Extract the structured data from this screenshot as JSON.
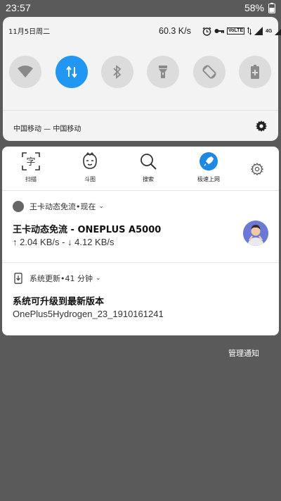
{
  "status_bar": {
    "time": "23:57",
    "battery": "58%"
  },
  "quick_settings": {
    "date": "11月5日周二",
    "speed": "60.3 K/s",
    "volte": "VoLTE",
    "network": "4G",
    "carrier": "中国移动 — 中国移动",
    "tiles": [
      "wifi",
      "mobile-data",
      "bluetooth",
      "flashlight",
      "auto-rotate",
      "battery-saver"
    ],
    "active_color": "#2196f3"
  },
  "shortcuts": [
    {
      "label": "扫描",
      "icon": "scan-text-icon"
    },
    {
      "label": "斗图",
      "icon": "emoji-face-icon"
    },
    {
      "label": "搜索",
      "icon": "search-icon"
    },
    {
      "label": "极速上网",
      "icon": "rocket-icon"
    }
  ],
  "notifications": [
    {
      "app": "王卡动态免流",
      "time_sep": " • ",
      "time": "现在",
      "title": "王卡动态免流 - ONEPLUS A5000",
      "subtitle": "↑ 2.04 KB/s  -  ↓ 4.12 KB/s"
    },
    {
      "app": "系统更新",
      "time_sep": " • ",
      "time": "41 分钟",
      "title": "系统可升级到最新版本",
      "subtitle": "OnePlus5Hydrogen_23_1910161241"
    }
  ],
  "manage_label": "管理通知"
}
